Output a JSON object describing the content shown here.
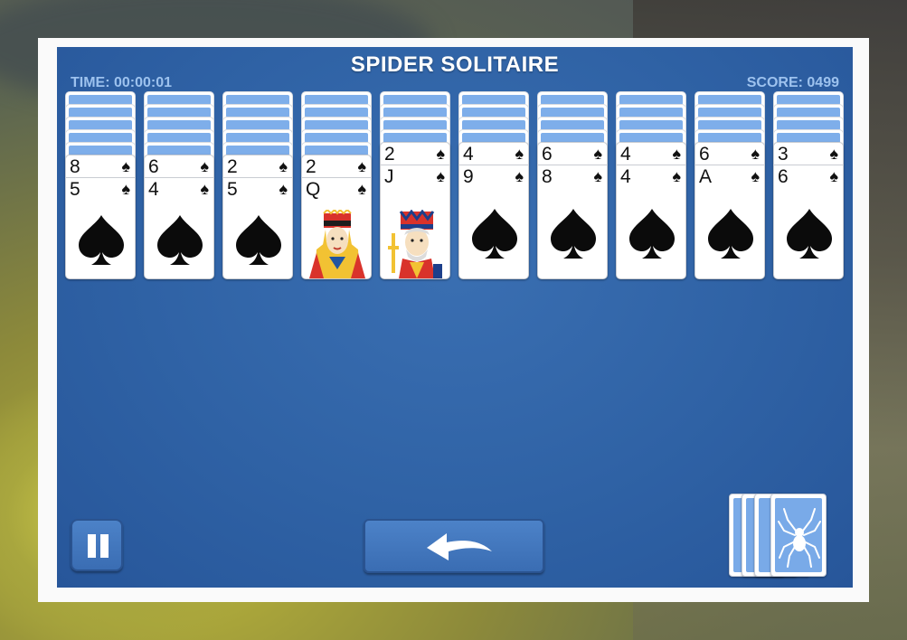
{
  "game": {
    "title": "SPIDER SOLITAIRE",
    "time": "TIME: 00:00:01",
    "score": "SCORE: 0499"
  },
  "colors": {
    "table": "#2f62a5",
    "card_back": "#7eaeea",
    "hud_text": "#9dc2ee"
  },
  "tableau": [
    {
      "hidden": 5,
      "cards": [
        {
          "rank": "8",
          "suit": "♠"
        },
        {
          "rank": "5",
          "suit": "♠"
        }
      ],
      "top_face": "spade"
    },
    {
      "hidden": 5,
      "cards": [
        {
          "rank": "6",
          "suit": "♠"
        },
        {
          "rank": "4",
          "suit": "♠"
        }
      ],
      "top_face": "spade"
    },
    {
      "hidden": 5,
      "cards": [
        {
          "rank": "2",
          "suit": "♠"
        },
        {
          "rank": "5",
          "suit": "♠"
        }
      ],
      "top_face": "spade"
    },
    {
      "hidden": 5,
      "cards": [
        {
          "rank": "2",
          "suit": "♠"
        },
        {
          "rank": "Q",
          "suit": "♠"
        }
      ],
      "top_face": "queen"
    },
    {
      "hidden": 4,
      "cards": [
        {
          "rank": "2",
          "suit": "♠"
        },
        {
          "rank": "J",
          "suit": "♠"
        }
      ],
      "top_face": "jack"
    },
    {
      "hidden": 4,
      "cards": [
        {
          "rank": "4",
          "suit": "♠"
        },
        {
          "rank": "9",
          "suit": "♠"
        }
      ],
      "top_face": "spade"
    },
    {
      "hidden": 4,
      "cards": [
        {
          "rank": "6",
          "suit": "♠"
        },
        {
          "rank": "8",
          "suit": "♠"
        }
      ],
      "top_face": "spade"
    },
    {
      "hidden": 4,
      "cards": [
        {
          "rank": "4",
          "suit": "♠"
        },
        {
          "rank": "4",
          "suit": "♠"
        }
      ],
      "top_face": "spade"
    },
    {
      "hidden": 4,
      "cards": [
        {
          "rank": "6",
          "suit": "♠"
        },
        {
          "rank": "A",
          "suit": "♠"
        }
      ],
      "top_face": "spade"
    },
    {
      "hidden": 4,
      "cards": [
        {
          "rank": "3",
          "suit": "♠"
        },
        {
          "rank": "6",
          "suit": "♠"
        }
      ],
      "top_face": "spade"
    }
  ],
  "controls": {
    "pause_icon": "pause-icon",
    "undo_icon": "undo-arrow-icon",
    "stock_icon": "spider-icon",
    "stock_piles": 4
  }
}
